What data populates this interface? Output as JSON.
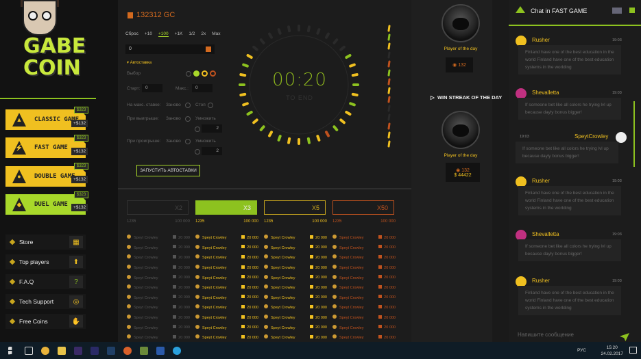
{
  "logo": {
    "line1": "GABE",
    "line2": "COIN"
  },
  "games": [
    {
      "label": "CLASSIC GAME",
      "badge_top": "$323",
      "badge_bottom": "+$132",
      "active": false
    },
    {
      "label": "FAST GAME",
      "badge_top": "$323",
      "badge_bottom": "+$132",
      "active": false
    },
    {
      "label": "DOUBLE GAME",
      "badge_top": "$323",
      "badge_bottom": "+$132",
      "active": false
    },
    {
      "label": "DUEL GAME",
      "badge_top": "$323",
      "badge_bottom": "+$132",
      "active": true
    }
  ],
  "menu": [
    {
      "label": "Store",
      "icon": "cart-icon"
    },
    {
      "label": "Top players",
      "icon": "up-arrow-icon"
    },
    {
      "label": "F.A.Q",
      "icon": "question-icon"
    },
    {
      "label": "Tech Support",
      "icon": "lifebuoy-icon"
    },
    {
      "label": "Free Coins",
      "icon": "hand-coins-icon"
    }
  ],
  "balance": "132312 GC",
  "bet_buttons": [
    "Сброс",
    "+10",
    "+100",
    "+1K",
    "1/2",
    "2x",
    "Max"
  ],
  "bet_selected": "+100",
  "bet_value": "0",
  "auto": {
    "heading": "Автоставка",
    "choice_label": "Выбор",
    "start_label": "Старт:",
    "start_value": "0",
    "max_label": "Макс.:",
    "max_value": "0",
    "on_max_label": "На макс. ставке:",
    "again_label": "Заново",
    "stop_label": "Стоп",
    "on_win_label": "При выигрыше:",
    "multiply_label": "Умножить",
    "win_multiplier": "2",
    "on_loss_label": "При проигрыше:",
    "loss_multiplier": "2",
    "start_button": "ЗАПУСТИТЬ АВТОСТАВКИ"
  },
  "timer": {
    "time": "00:20",
    "sub": "TO END"
  },
  "multipliers": [
    {
      "label": "X2",
      "count": "1235",
      "total": "100 000",
      "color": "#555555"
    },
    {
      "label": "X3",
      "count": "1235",
      "total": "100 000",
      "color": "#8dc21f"
    },
    {
      "label": "X5",
      "count": "1235",
      "total": "100 000",
      "color": "#c9a61e"
    },
    {
      "label": "X50",
      "count": "1235",
      "total": "100 000",
      "color": "#c0521e"
    }
  ],
  "bets_row": {
    "name": "Speyt Crowley",
    "amount": "20 000"
  },
  "right_panel": {
    "player_of_day_1": "Player of the day",
    "stat1": "132",
    "streak_title": "WIN STREAK OF THE DAY",
    "player_of_day_2": "Player of the day",
    "stat2a": "132",
    "stat2b": "44422"
  },
  "chat": {
    "title": "Chat in FAST GAME",
    "input_placeholder": "Напишите сообщение",
    "messages": [
      {
        "user": "Rusher",
        "time": "19:03",
        "text": "Finland have one of the best education in the world Finland have one of the best education systems in the worlding"
      },
      {
        "user": "Shevalletta",
        "time": "19:03",
        "text": "If someone bet like all colors he trying lvl up because dayly bonus bigger!"
      },
      {
        "user": "SpeytCrowley",
        "time": "19:03",
        "text": "If someone bet like all colors he trying lvl up because dayly bonus bigger!"
      },
      {
        "user": "Rusher",
        "time": "19:03",
        "text": "Finland have one of the best education in the world Finland have one of the best education systems in the worlding"
      },
      {
        "user": "Shevalletta",
        "time": "19:03",
        "text": "If someone bet like all colors he trying lvl up because dayly bonus bigger!"
      },
      {
        "user": "Rusher",
        "time": "19:03",
        "text": "Finland have one of the best education in the world Finland have one of the best education systems in the worlding"
      }
    ]
  },
  "taskbar": {
    "lang": "РУС",
    "time": "15:20",
    "date": "24.02.2017"
  }
}
